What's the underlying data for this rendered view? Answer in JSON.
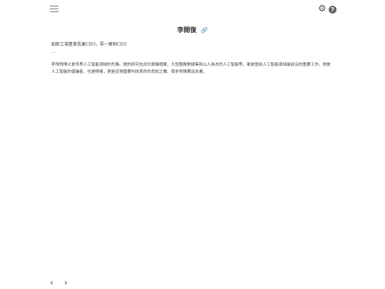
{
  "header": {
    "menu_icon": "hamburger-menu-icon",
    "settings_icon": "gear-icon",
    "help_label": "?"
  },
  "article": {
    "title": "李開復",
    "link_icon": "link-icon",
    "subtitle": "創新工場董事長兼CEO，零一萬物CEO",
    "separator": "—",
    "body": "李飛飛博士是世界人工智能領域的先鋒。她的研究包含計算機視覺、大型圖像數據集和以人為本的人工智能等，都是當前人工智能領域最前沿的重要工作。她是人工智能的倡議者，也是榜樣，更是這場重要科技革命的良知之聲。我非常推薦這本書。"
  },
  "footer": {
    "prev_label": "‹",
    "next_label": "›"
  }
}
